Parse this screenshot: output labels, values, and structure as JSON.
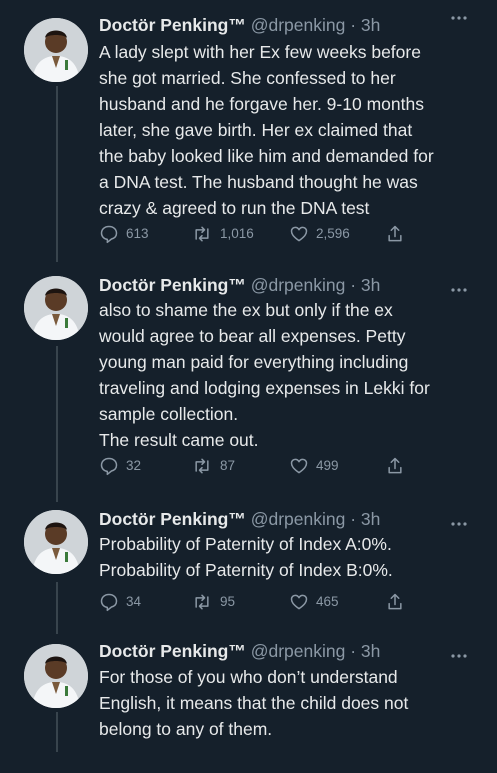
{
  "tweets": [
    {
      "name": "Doctör Penking™",
      "handle": "@drpenking",
      "time": "3h",
      "text": "A lady slept with her Ex few weeks before\nshe got married. She confessed to her\nhusband and he forgave her. 9-10 months\nlater, she gave birth. Her ex claimed that\nthe baby looked like him and demanded for\na DNA test. The husband thought he was\ncrazy & agreed to run the DNA test",
      "replies": "613",
      "retweets": "1,016",
      "likes": "2,596"
    },
    {
      "name": "Doctör Penking™",
      "handle": "@drpenking",
      "time": "3h",
      "text": "also to shame the ex but only if the ex\nwould agree to bear all expenses. Petty\nyoung man paid for everything including\ntraveling and lodging expenses in Lekki for\nsample collection.\nThe result came out.",
      "replies": "32",
      "retweets": "87",
      "likes": "499"
    },
    {
      "name": "Doctör Penking™",
      "handle": "@drpenking",
      "time": "3h",
      "text": "Probability of Paternity of Index A:0%.\nProbability of Paternity of Index B:0%.",
      "replies": "34",
      "retweets": "95",
      "likes": "465"
    },
    {
      "name": "Doctör Penking™",
      "handle": "@drpenking",
      "time": "3h",
      "text": "For those of you who don’t understand\nEnglish, it means that the child does not\nbelong to any of them."
    }
  ],
  "icons": {
    "reply": "reply-icon",
    "retweet": "retweet-icon",
    "like": "heart-icon",
    "share": "share-icon",
    "more": "more-icon"
  },
  "colors": {
    "background": "#15202b",
    "text": "#e7e9ea",
    "secondary": "#8b98a5",
    "thread_line": "#38444d"
  }
}
